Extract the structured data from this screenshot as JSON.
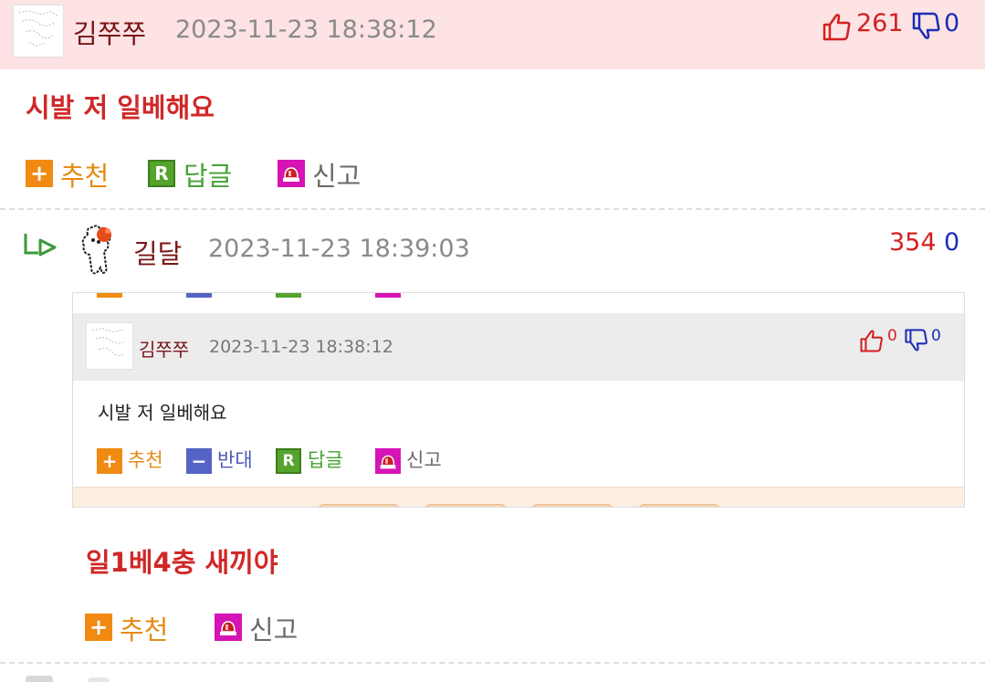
{
  "comment1": {
    "nickname": "김쭈쭈",
    "timestamp": "2023-11-23 18:38:12",
    "upvotes": "261",
    "downvotes": "0",
    "body": "시발 저 일베해요",
    "actions": {
      "recommend": "추천",
      "reply": "답글",
      "report": "신고"
    }
  },
  "comment2": {
    "nickname": "길달",
    "timestamp": "2023-11-23 18:39:03",
    "upvotes": "354",
    "downvotes": "0",
    "quote": {
      "nickname": "김쭈쭈",
      "timestamp": "2023-11-23 18:38:12",
      "upvotes": "0",
      "downvotes": "0",
      "body": "시발 저 일베해요",
      "actions": {
        "recommend": "추천",
        "oppose": "반대",
        "reply": "답글",
        "report": "신고"
      }
    },
    "body": "일1베4충 새끼야",
    "actions": {
      "recommend": "추천",
      "report": "신고"
    }
  },
  "icons": {
    "recommend": "plus-icon",
    "oppose": "minus-icon",
    "reply": "reply-r-icon",
    "report": "siren-icon",
    "upvote": "thumbs-up-icon",
    "downvote": "thumbs-down-icon",
    "reply_indicator": "reply-arrow-icon"
  },
  "colors": {
    "header_bg": "#fde3e4",
    "nickname": "#7a1515",
    "body_text": "#d02828",
    "upvote": "#d32020",
    "downvote": "#1a2eb5",
    "recommend": "#e68a16",
    "reply": "#46a234",
    "report": "#d613b5",
    "oppose": "#4a5ab5"
  }
}
